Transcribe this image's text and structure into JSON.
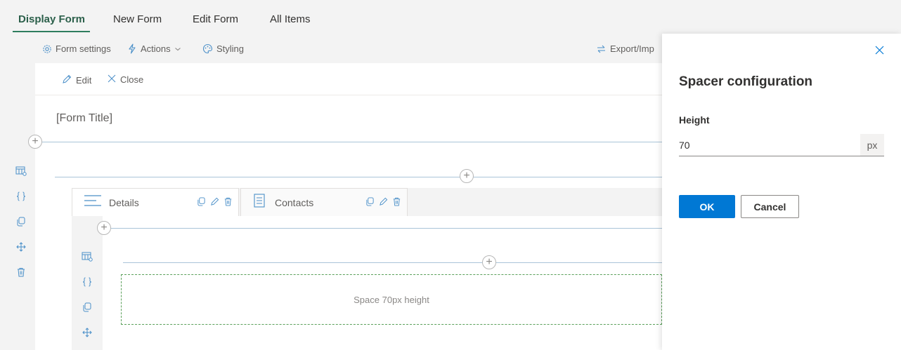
{
  "top_tabs": [
    {
      "label": "Display Form",
      "active": true
    },
    {
      "label": "New Form",
      "active": false
    },
    {
      "label": "Edit Form",
      "active": false
    },
    {
      "label": "All Items",
      "active": false
    }
  ],
  "toolbar": {
    "form_settings": "Form settings",
    "actions": "Actions",
    "styling": "Styling",
    "export_import": "Export/Imp"
  },
  "command_bar": {
    "edit": "Edit",
    "close": "Close"
  },
  "form": {
    "title": "[Form Title]",
    "tabs": [
      {
        "label": "Details",
        "icon": "lines-icon",
        "active": true
      },
      {
        "label": "Contacts",
        "icon": "list-document-icon",
        "active": false
      }
    ],
    "spacer_text": "Space 70px height"
  },
  "panel": {
    "title": "Spacer configuration",
    "height_label": "Height",
    "height_value": "70",
    "height_unit": "px",
    "ok_label": "OK",
    "cancel_label": "Cancel"
  },
  "colors": {
    "accent": "#0078d4",
    "active_tab": "#2b5f4a",
    "icon_blue": "#4a8fc8",
    "spacer_border": "#5aa05a"
  }
}
